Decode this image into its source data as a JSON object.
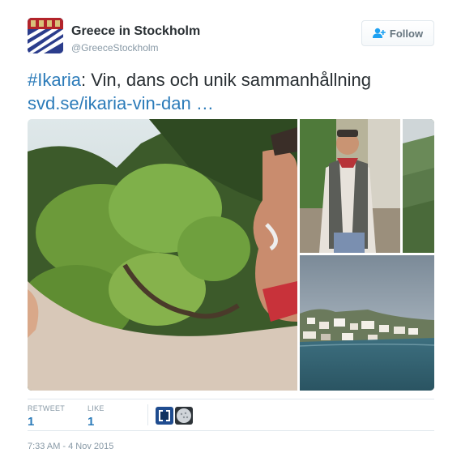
{
  "account": {
    "name": "Greece in Stockholm",
    "handle": "@GreeceStockholm"
  },
  "follow_label": "Follow",
  "tweet": {
    "hashtag": "#Ikaria",
    "text": ": Vin, dans och unik sammanhållning",
    "link": "svd.se/ikaria-vin-dan …"
  },
  "stats": {
    "retweet_label": "RETWEET",
    "retweet_count": "1",
    "like_label": "LIKE",
    "like_count": "1"
  },
  "timestamp": "7:33 AM - 4 Nov 2015",
  "colors": {
    "link": "#2b7bb9",
    "text": "#292f33",
    "muted": "#8899a6"
  },
  "icons": {
    "follow": "person-add-icon"
  }
}
